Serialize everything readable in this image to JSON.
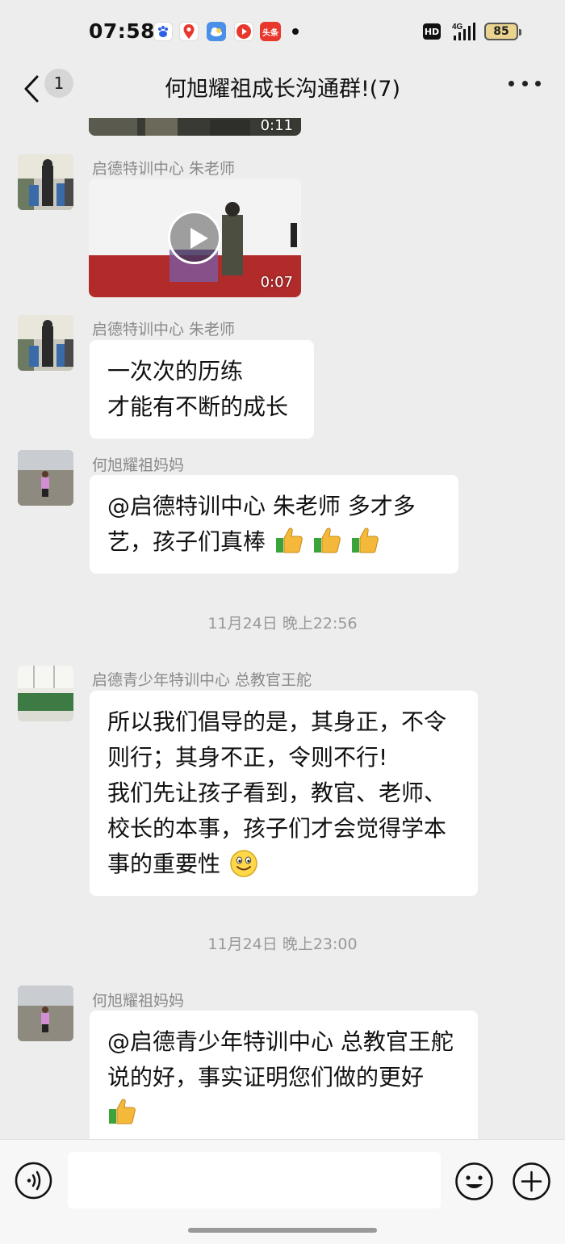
{
  "status_bar": {
    "time": "07:58",
    "app_icons": [
      "baidu-icon",
      "map-pin-app-icon",
      "weather-app-icon",
      "video-app-icon",
      "toutiao-app-icon"
    ],
    "toutiao_label": "头条",
    "network_hd": "HD",
    "network_type": "4G",
    "battery": "85"
  },
  "header": {
    "back_count": "1",
    "title": "何旭耀祖成长沟通群!(7)"
  },
  "messages": {
    "m0": {
      "type": "video",
      "duration": "0:11"
    },
    "m1": {
      "sender": "启德特训中心  朱老师",
      "type": "video",
      "duration": "0:07"
    },
    "m2": {
      "sender": "启德特训中心  朱老师",
      "lines": [
        "一次次的历练",
        "才能有不断的成长"
      ]
    },
    "m3": {
      "sender": "何旭耀祖妈妈",
      "lines": [
        "@启德特训中心  朱老师  多才多",
        "艺，孩子们真棒"
      ],
      "emoji": "thumbs-up x3"
    },
    "ts1": "11月24日 晚上22:56",
    "m4": {
      "sender": "启德青少年特训中心 总教官王舵",
      "lines": [
        "所以我们倡导的是，其身正，不令",
        "则行；其身不正，令则不行!",
        "我们先让孩子看到，教官、老师、",
        "校长的本事，孩子们才会觉得学本",
        "事的重要性"
      ],
      "emoji": "smile"
    },
    "ts2": "11月24日 晚上23:00",
    "m5": {
      "sender": "何旭耀祖妈妈",
      "lines": [
        "@启德青少年特训中心 总教官王舵",
        " 说的好，事实证明您们做的更好"
      ],
      "emoji": "thumbs-up"
    }
  },
  "input_bar": {
    "placeholder": "",
    "icons": [
      "voice-icon",
      "emoji-icon",
      "plus-icon"
    ]
  },
  "colors": {
    "background": "#ededed",
    "bubble": "#ffffff",
    "meta_text": "#8a8a8a",
    "input_bar": "#f7f7f7"
  }
}
